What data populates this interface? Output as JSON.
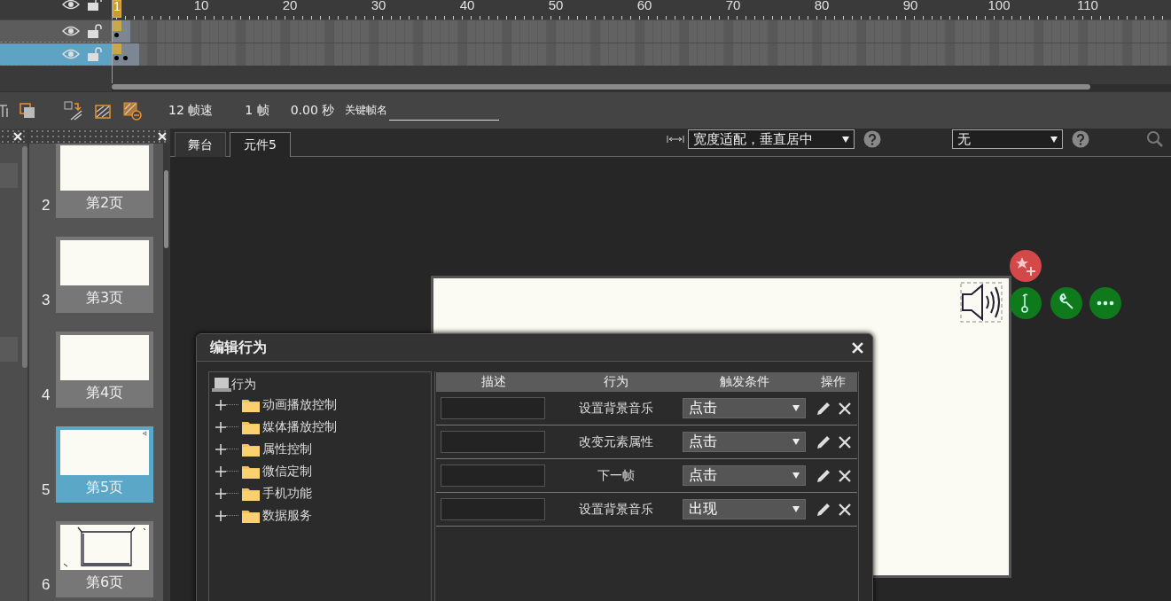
{
  "timeline": {
    "ruler_labels": [
      "1",
      "10",
      "20",
      "30",
      "40",
      "50",
      "60",
      "70",
      "80",
      "90",
      "100",
      "110"
    ],
    "layers": [
      {
        "selected": false,
        "frames": [
          {
            "kind": "keyframe"
          }
        ]
      },
      {
        "selected": true,
        "frames": [
          {
            "kind": "keyframe"
          },
          {
            "kind": "keyframe"
          }
        ]
      }
    ]
  },
  "toolbar": {
    "frame_rate": "12 帧速",
    "frame": "1 帧",
    "time": "0.00 秒",
    "keyframe_name_label": "关键帧名"
  },
  "pages": [
    {
      "number": "2",
      "label": "第2页",
      "selected": false,
      "kind": "blank"
    },
    {
      "number": "3",
      "label": "第3页",
      "selected": false,
      "kind": "blank"
    },
    {
      "number": "4",
      "label": "第4页",
      "selected": false,
      "kind": "blank"
    },
    {
      "number": "5",
      "label": "第5页",
      "selected": true,
      "kind": "speaker"
    },
    {
      "number": "6",
      "label": "第6页",
      "selected": false,
      "kind": "sketch"
    }
  ],
  "stage_tabs": [
    {
      "label": "舞台",
      "selected": false
    },
    {
      "label": "元件5",
      "selected": true
    }
  ],
  "stage_toolbar": {
    "fit_mode": "宽度适配，垂直居中",
    "second_select": "无"
  },
  "dialog": {
    "title": "编辑行为",
    "tree": {
      "label": "行为",
      "children": [
        {
          "label": "动画播放控制",
          "expanded": false
        },
        {
          "label": "媒体播放控制",
          "expanded": false
        },
        {
          "label": "属性控制",
          "expanded": false
        },
        {
          "label": "微信定制",
          "expanded": false
        },
        {
          "label": "手机功能",
          "expanded": false
        },
        {
          "label": "数据服务",
          "expanded": false
        }
      ]
    },
    "columns": [
      "描述",
      "行为",
      "触发条件",
      "操作"
    ],
    "rows": [
      {
        "action": "设置背景音乐",
        "trigger": "点击"
      },
      {
        "action": "改变元素属性",
        "trigger": "点击"
      },
      {
        "action": "下一帧",
        "trigger": "点击"
      },
      {
        "action": "设置背景音乐",
        "trigger": "出现"
      }
    ]
  }
}
